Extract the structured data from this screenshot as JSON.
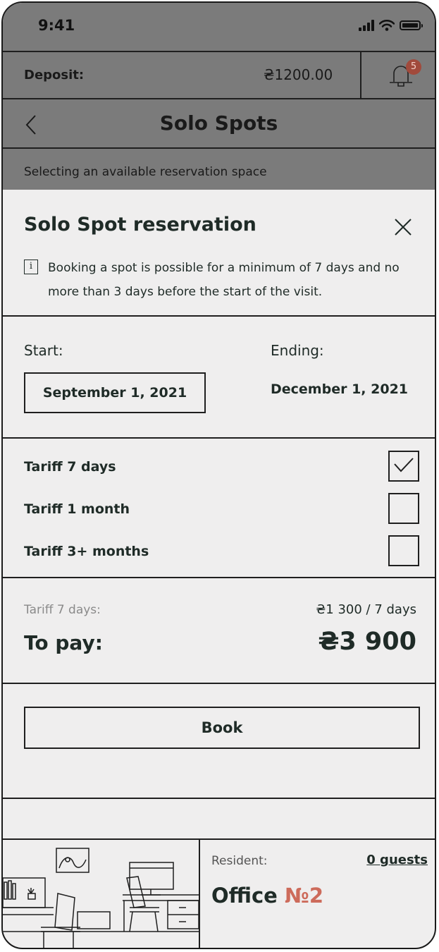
{
  "status_bar": {
    "time": "9:41",
    "icons": [
      "signal-icon",
      "wifi-icon",
      "battery-icon"
    ]
  },
  "deposit": {
    "label": "Deposit:",
    "value": "₴1200.00",
    "notifications_count": "5"
  },
  "header": {
    "title": "Solo Spots"
  },
  "subtitle": "Selecting an available reservation space",
  "modal": {
    "title": "Solo Spot reservation",
    "info_icon_text": "i",
    "info_text": "Booking a spot is possible for a minimum of 7 days and no more than 3 days before the start of the visit."
  },
  "dates": {
    "start_label": "Start:",
    "start_value": "September 1, 2021",
    "end_label": "Ending:",
    "end_value": "December 1, 2021"
  },
  "tariffs": [
    {
      "label": "Tariff 7 days",
      "checked": true
    },
    {
      "label": "Tariff 1 month",
      "checked": false
    },
    {
      "label": "Tariff 3+ months",
      "checked": false
    }
  ],
  "summary": {
    "tariff_label": "Tariff 7 days:",
    "rate": "₴1 300 / 7 days",
    "pay_label": "To pay:",
    "pay_value": "₴3 900"
  },
  "book_label": "Book",
  "footer": {
    "resident_label": "Resident:",
    "guests": "0 guests",
    "office_name": "Office",
    "office_number": "№2"
  },
  "colors": {
    "overlay": "#7b7b7b",
    "background": "#efeeee",
    "text": "#1f2b27",
    "accent": "#cd6b5b",
    "badge": "#a14a3c"
  }
}
